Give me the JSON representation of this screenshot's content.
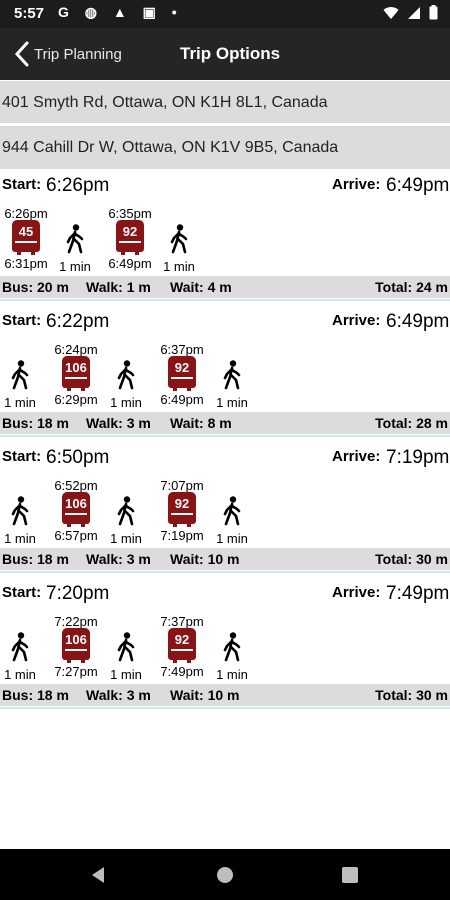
{
  "status": {
    "time": "5:57",
    "left_icons": "G ◍ ▲ ▣ •"
  },
  "header": {
    "back_label": "Trip Planning",
    "title": "Trip Options"
  },
  "route": {
    "from": "401 Smyth Rd, Ottawa, ON K1H 8L1, Canada",
    "to": "944 Cahill Dr W, Ottawa, ON K1V 9B5, Canada"
  },
  "labels": {
    "start": "Start:",
    "arrive": "Arrive:"
  },
  "colors": {
    "bus": "#8a1414",
    "summary_bg": "#dcdcdc",
    "address_bg": "#dcdcdc",
    "separator": "#cde4f5"
  },
  "trips": [
    {
      "start": "6:26pm",
      "arrive": "6:49pm",
      "legs": [
        {
          "type": "bus",
          "route": "45",
          "depart": "6:26pm",
          "arrive": "6:31pm"
        },
        {
          "type": "walk",
          "duration": "1 min"
        },
        {
          "type": "bus",
          "route": "92",
          "depart": "6:35pm",
          "arrive": "6:49pm"
        },
        {
          "type": "walk",
          "duration": "1 min"
        }
      ],
      "summary": {
        "bus": "Bus: 20 m",
        "walk": "Walk: 1 m",
        "wait": "Wait: 4 m",
        "total": "Total: 24 m"
      }
    },
    {
      "start": "6:22pm",
      "arrive": "6:49pm",
      "legs": [
        {
          "type": "walk",
          "duration": "1 min"
        },
        {
          "type": "bus",
          "route": "106",
          "depart": "6:24pm",
          "arrive": "6:29pm"
        },
        {
          "type": "walk",
          "duration": "1 min"
        },
        {
          "type": "bus",
          "route": "92",
          "depart": "6:37pm",
          "arrive": "6:49pm"
        },
        {
          "type": "walk",
          "duration": "1 min"
        }
      ],
      "summary": {
        "bus": "Bus: 18 m",
        "walk": "Walk: 3 m",
        "wait": "Wait: 8 m",
        "total": "Total: 28 m"
      }
    },
    {
      "start": "6:50pm",
      "arrive": "7:19pm",
      "legs": [
        {
          "type": "walk",
          "duration": "1 min"
        },
        {
          "type": "bus",
          "route": "106",
          "depart": "6:52pm",
          "arrive": "6:57pm"
        },
        {
          "type": "walk",
          "duration": "1 min"
        },
        {
          "type": "bus",
          "route": "92",
          "depart": "7:07pm",
          "arrive": "7:19pm"
        },
        {
          "type": "walk",
          "duration": "1 min"
        }
      ],
      "summary": {
        "bus": "Bus: 18 m",
        "walk": "Walk: 3 m",
        "wait": "Wait: 10 m",
        "total": "Total: 30 m"
      }
    },
    {
      "start": "7:20pm",
      "arrive": "7:49pm",
      "legs": [
        {
          "type": "walk",
          "duration": "1 min"
        },
        {
          "type": "bus",
          "route": "106",
          "depart": "7:22pm",
          "arrive": "7:27pm"
        },
        {
          "type": "walk",
          "duration": "1 min"
        },
        {
          "type": "bus",
          "route": "92",
          "depart": "7:37pm",
          "arrive": "7:49pm"
        },
        {
          "type": "walk",
          "duration": "1 min"
        }
      ],
      "summary": {
        "bus": "Bus: 18 m",
        "walk": "Walk: 3 m",
        "wait": "Wait: 10 m",
        "total": "Total: 30 m"
      }
    }
  ]
}
